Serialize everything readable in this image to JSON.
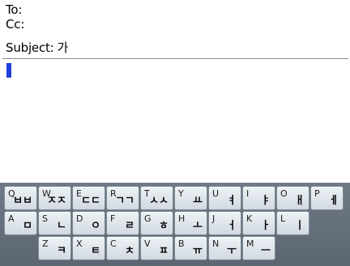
{
  "compose": {
    "to_label": "To:",
    "to_value": "",
    "cc_label": "Cc:",
    "cc_value": "",
    "subject_label": "Subject:",
    "subject_value": "가",
    "body_text": ""
  },
  "keyboard": {
    "rows": [
      [
        {
          "latin": "Q",
          "hangul": "ㅂㅂ"
        },
        {
          "latin": "W",
          "hangul": "ㅈㅈ"
        },
        {
          "latin": "E",
          "hangul": "ㄷㄷ"
        },
        {
          "latin": "R",
          "hangul": "ㄱㄱ"
        },
        {
          "latin": "T",
          "hangul": "ㅅㅅ"
        },
        {
          "latin": "Y",
          "hangul": "ㅛ"
        },
        {
          "latin": "U",
          "hangul": "ㅕ"
        },
        {
          "latin": "I",
          "hangul": "ㅑ"
        },
        {
          "latin": "O",
          "hangul": "ㅐ"
        },
        {
          "latin": "P",
          "hangul": "ㅔ"
        }
      ],
      [
        {
          "latin": "A",
          "hangul": "ㅁ"
        },
        {
          "latin": "S",
          "hangul": "ㄴ"
        },
        {
          "latin": "D",
          "hangul": "ㅇ"
        },
        {
          "latin": "F",
          "hangul": "ㄹ"
        },
        {
          "latin": "G",
          "hangul": "ㅎ"
        },
        {
          "latin": "H",
          "hangul": "ㅗ"
        },
        {
          "latin": "J",
          "hangul": "ㅓ"
        },
        {
          "latin": "K",
          "hangul": "ㅏ"
        },
        {
          "latin": "L",
          "hangul": "ㅣ"
        }
      ],
      [
        {
          "latin": "Z",
          "hangul": "ㅋ"
        },
        {
          "latin": "X",
          "hangul": "ㅌ"
        },
        {
          "latin": "C",
          "hangul": "ㅊ"
        },
        {
          "latin": "V",
          "hangul": "ㅍ"
        },
        {
          "latin": "B",
          "hangul": "ㅠ"
        },
        {
          "latin": "N",
          "hangul": "ㅜ"
        },
        {
          "latin": "M",
          "hangul": "ㅡ"
        }
      ]
    ]
  }
}
